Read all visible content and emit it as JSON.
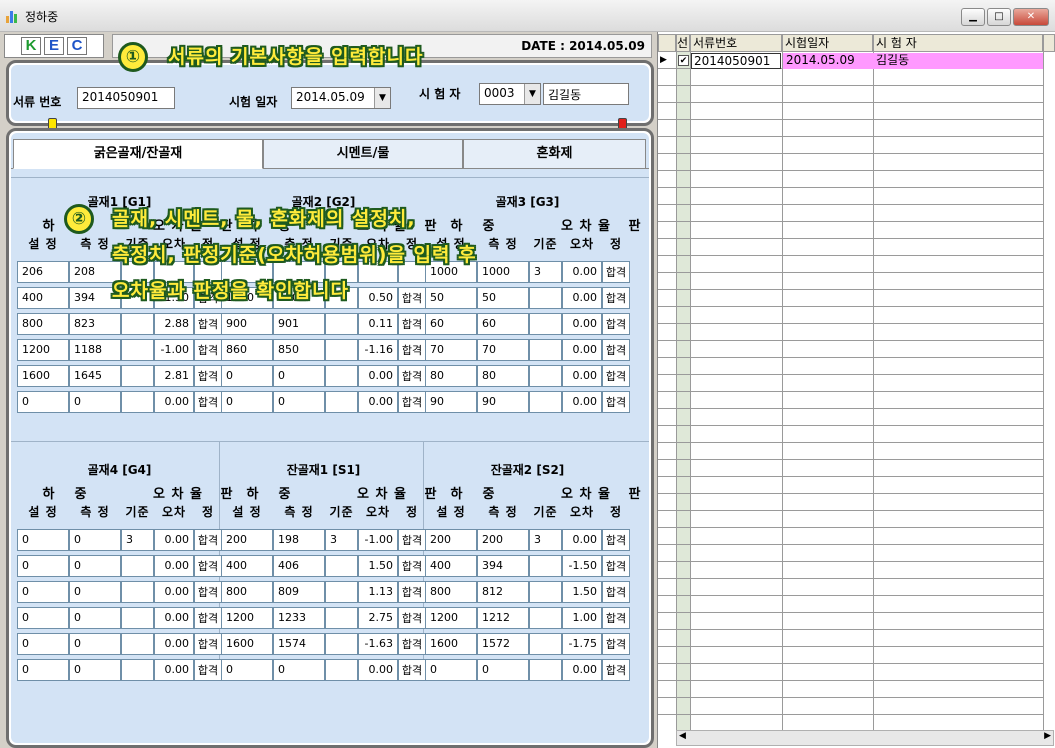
{
  "window": {
    "title": "정하중"
  },
  "logo": [
    "K",
    "E",
    "C"
  ],
  "date_label": "DATE : 2014.05.09",
  "basic": {
    "doc_no_label": "서류 번호",
    "doc_no": "2014050901",
    "test_date_label": "시험 일자",
    "test_date": "2014.05.09",
    "tester_label": "시 험 자",
    "tester_code": "0003",
    "tester_name": "김길동"
  },
  "tabs": [
    "굵은골재/잔골재",
    "시멘트/물",
    "혼화제"
  ],
  "headers": {
    "line1": [
      "하",
      "중",
      "오 차 율",
      "판"
    ],
    "line2": [
      "설 정",
      "측 정",
      "기준",
      "오차",
      "정"
    ]
  },
  "sections": [
    {
      "title": "골재1 [G1]",
      "rows": [
        {
          "set": "206",
          "meas": "208",
          "std": "",
          "err": "",
          "judge": ""
        },
        {
          "set": "400",
          "meas": "394",
          "std": "",
          "err": "-1.50",
          "judge": "합격"
        },
        {
          "set": "800",
          "meas": "823",
          "std": "",
          "err": "2.88",
          "judge": "합격"
        },
        {
          "set": "1200",
          "meas": "1188",
          "std": "",
          "err": "-1.00",
          "judge": "합격"
        },
        {
          "set": "1600",
          "meas": "1645",
          "std": "",
          "err": "2.81",
          "judge": "합격"
        },
        {
          "set": "0",
          "meas": "0",
          "std": "",
          "err": "0.00",
          "judge": "합격"
        }
      ]
    },
    {
      "title": "골재2 [G2]",
      "rows": [
        {
          "set": "",
          "meas": "",
          "std": "",
          "err": "",
          "judge": ""
        },
        {
          "set": "1000",
          "meas": "1005",
          "std": "",
          "err": "0.50",
          "judge": "합격"
        },
        {
          "set": "900",
          "meas": "901",
          "std": "",
          "err": "0.11",
          "judge": "합격"
        },
        {
          "set": "860",
          "meas": "850",
          "std": "",
          "err": "-1.16",
          "judge": "합격"
        },
        {
          "set": "0",
          "meas": "0",
          "std": "",
          "err": "0.00",
          "judge": "합격"
        },
        {
          "set": "0",
          "meas": "0",
          "std": "",
          "err": "0.00",
          "judge": "합격"
        }
      ]
    },
    {
      "title": "골재3 [G3]",
      "rows": [
        {
          "set": "1000",
          "meas": "1000",
          "std": "3",
          "err": "0.00",
          "judge": "합격"
        },
        {
          "set": "50",
          "meas": "50",
          "std": "",
          "err": "0.00",
          "judge": "합격"
        },
        {
          "set": "60",
          "meas": "60",
          "std": "",
          "err": "0.00",
          "judge": "합격"
        },
        {
          "set": "70",
          "meas": "70",
          "std": "",
          "err": "0.00",
          "judge": "합격"
        },
        {
          "set": "80",
          "meas": "80",
          "std": "",
          "err": "0.00",
          "judge": "합격"
        },
        {
          "set": "90",
          "meas": "90",
          "std": "",
          "err": "0.00",
          "judge": "합격"
        }
      ]
    },
    {
      "title": "골재4 [G4]",
      "rows": [
        {
          "set": "0",
          "meas": "0",
          "std": "3",
          "err": "0.00",
          "judge": "합격"
        },
        {
          "set": "0",
          "meas": "0",
          "std": "",
          "err": "0.00",
          "judge": "합격"
        },
        {
          "set": "0",
          "meas": "0",
          "std": "",
          "err": "0.00",
          "judge": "합격"
        },
        {
          "set": "0",
          "meas": "0",
          "std": "",
          "err": "0.00",
          "judge": "합격"
        },
        {
          "set": "0",
          "meas": "0",
          "std": "",
          "err": "0.00",
          "judge": "합격"
        },
        {
          "set": "0",
          "meas": "0",
          "std": "",
          "err": "0.00",
          "judge": "합격"
        }
      ]
    },
    {
      "title": "잔골재1 [S1]",
      "rows": [
        {
          "set": "200",
          "meas": "198",
          "std": "3",
          "err": "-1.00",
          "judge": "합격"
        },
        {
          "set": "400",
          "meas": "406",
          "std": "",
          "err": "1.50",
          "judge": "합격"
        },
        {
          "set": "800",
          "meas": "809",
          "std": "",
          "err": "1.13",
          "judge": "합격"
        },
        {
          "set": "1200",
          "meas": "1233",
          "std": "",
          "err": "2.75",
          "judge": "합격"
        },
        {
          "set": "1600",
          "meas": "1574",
          "std": "",
          "err": "-1.63",
          "judge": "합격"
        },
        {
          "set": "0",
          "meas": "0",
          "std": "",
          "err": "0.00",
          "judge": "합격"
        }
      ]
    },
    {
      "title": "잔골재2 [S2]",
      "rows": [
        {
          "set": "200",
          "meas": "200",
          "std": "3",
          "err": "0.00",
          "judge": "합격"
        },
        {
          "set": "400",
          "meas": "394",
          "std": "",
          "err": "-1.50",
          "judge": "합격"
        },
        {
          "set": "800",
          "meas": "812",
          "std": "",
          "err": "1.50",
          "judge": "합격"
        },
        {
          "set": "1200",
          "meas": "1212",
          "std": "",
          "err": "1.00",
          "judge": "합격"
        },
        {
          "set": "1600",
          "meas": "1572",
          "std": "",
          "err": "-1.75",
          "judge": "합격"
        },
        {
          "set": "0",
          "meas": "0",
          "std": "",
          "err": "0.00",
          "judge": "합격"
        }
      ]
    }
  ],
  "grid": {
    "columns": [
      "선",
      "서류번호",
      "시험일자",
      "시 험 자"
    ],
    "rows": [
      {
        "selected": true,
        "doc_no": "2014050901",
        "date": "2014.05.09",
        "tester": "김길동"
      }
    ]
  },
  "callouts": {
    "c1_num": "①",
    "c1_text": "서류의 기본사항을 입력합니다",
    "c2_num": "②",
    "c2_line1": "골재, 시멘트, 물, 혼화제의 설정치,",
    "c2_line2": "측정치, 판정기준(오차허용범위)을 입력 후",
    "c2_line3": "오차율과 판정을 확인합니다"
  },
  "colors": {
    "row_highlight": "#ff99ff",
    "panel_bg": "#d3e3f5",
    "callout_text": "#ffeb3b"
  }
}
